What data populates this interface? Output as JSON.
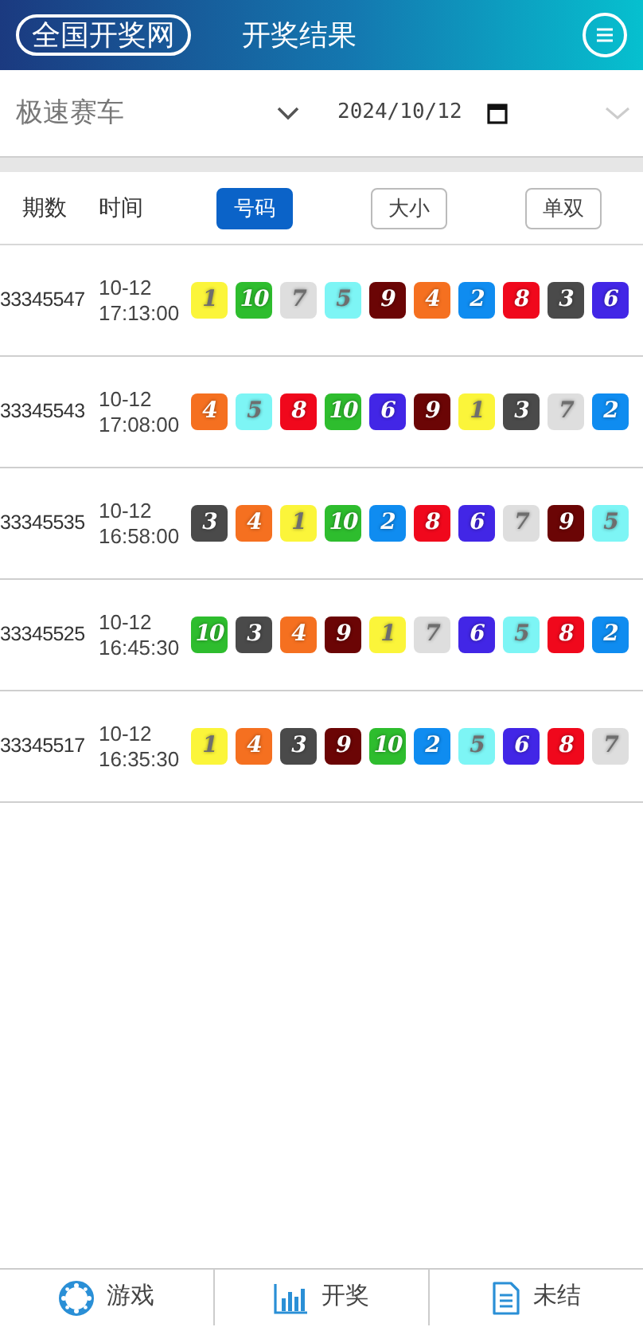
{
  "header": {
    "logo": "全国开奖网",
    "title": "开奖结果"
  },
  "filter": {
    "game": "极速赛车",
    "date": "2024/10/12"
  },
  "columns": [
    "期数",
    "时间"
  ],
  "view_tabs": [
    {
      "label": "号码",
      "selected": true
    },
    {
      "label": "大小",
      "selected": false
    },
    {
      "label": "单双",
      "selected": false
    }
  ],
  "draws": [
    {
      "issue": "33345547",
      "date": "10-12",
      "time": "17:13:00",
      "balls": [
        {
          "n": "1",
          "color": "#fbf53a"
        },
        {
          "n": "10",
          "color": "#2ebd2e"
        },
        {
          "n": "7",
          "color": "#dedede"
        },
        {
          "n": "5",
          "color": "#7df5f5"
        },
        {
          "n": "9",
          "color": "#6b0505"
        },
        {
          "n": "4",
          "color": "#f57020"
        },
        {
          "n": "2",
          "color": "#0f8cf0"
        },
        {
          "n": "8",
          "color": "#f0081c"
        },
        {
          "n": "3",
          "color": "#4a4a4a"
        },
        {
          "n": "6",
          "color": "#4226e6"
        }
      ]
    },
    {
      "issue": "33345543",
      "date": "10-12",
      "time": "17:08:00",
      "balls": [
        {
          "n": "4",
          "color": "#f57020"
        },
        {
          "n": "5",
          "color": "#7df5f5"
        },
        {
          "n": "8",
          "color": "#f0081c"
        },
        {
          "n": "10",
          "color": "#2ebd2e"
        },
        {
          "n": "6",
          "color": "#4226e6"
        },
        {
          "n": "9",
          "color": "#6b0505"
        },
        {
          "n": "1",
          "color": "#fbf53a"
        },
        {
          "n": "3",
          "color": "#4a4a4a"
        },
        {
          "n": "7",
          "color": "#dedede"
        },
        {
          "n": "2",
          "color": "#0f8cf0"
        }
      ]
    },
    {
      "issue": "33345535",
      "date": "10-12",
      "time": "16:58:00",
      "balls": [
        {
          "n": "3",
          "color": "#4a4a4a"
        },
        {
          "n": "4",
          "color": "#f57020"
        },
        {
          "n": "1",
          "color": "#fbf53a"
        },
        {
          "n": "10",
          "color": "#2ebd2e"
        },
        {
          "n": "2",
          "color": "#0f8cf0"
        },
        {
          "n": "8",
          "color": "#f0081c"
        },
        {
          "n": "6",
          "color": "#4226e6"
        },
        {
          "n": "7",
          "color": "#dedede"
        },
        {
          "n": "9",
          "color": "#6b0505"
        },
        {
          "n": "5",
          "color": "#7df5f5"
        }
      ]
    },
    {
      "issue": "33345525",
      "date": "10-12",
      "time": "16:45:30",
      "balls": [
        {
          "n": "10",
          "color": "#2ebd2e"
        },
        {
          "n": "3",
          "color": "#4a4a4a"
        },
        {
          "n": "4",
          "color": "#f57020"
        },
        {
          "n": "9",
          "color": "#6b0505"
        },
        {
          "n": "1",
          "color": "#fbf53a"
        },
        {
          "n": "7",
          "color": "#dedede"
        },
        {
          "n": "6",
          "color": "#4226e6"
        },
        {
          "n": "5",
          "color": "#7df5f5"
        },
        {
          "n": "8",
          "color": "#f0081c"
        },
        {
          "n": "2",
          "color": "#0f8cf0"
        }
      ]
    },
    {
      "issue": "33345517",
      "date": "10-12",
      "time": "16:35:30",
      "balls": [
        {
          "n": "1",
          "color": "#fbf53a"
        },
        {
          "n": "4",
          "color": "#f57020"
        },
        {
          "n": "3",
          "color": "#4a4a4a"
        },
        {
          "n": "9",
          "color": "#6b0505"
        },
        {
          "n": "10",
          "color": "#2ebd2e"
        },
        {
          "n": "2",
          "color": "#0f8cf0"
        },
        {
          "n": "5",
          "color": "#7df5f5"
        },
        {
          "n": "6",
          "color": "#4226e6"
        },
        {
          "n": "8",
          "color": "#f0081c"
        },
        {
          "n": "7",
          "color": "#dedede"
        }
      ]
    }
  ],
  "bottom_nav": [
    {
      "kind": "games",
      "label": "游戏"
    },
    {
      "kind": "results",
      "label": "开奖"
    },
    {
      "kind": "pending",
      "label": "未结"
    }
  ]
}
